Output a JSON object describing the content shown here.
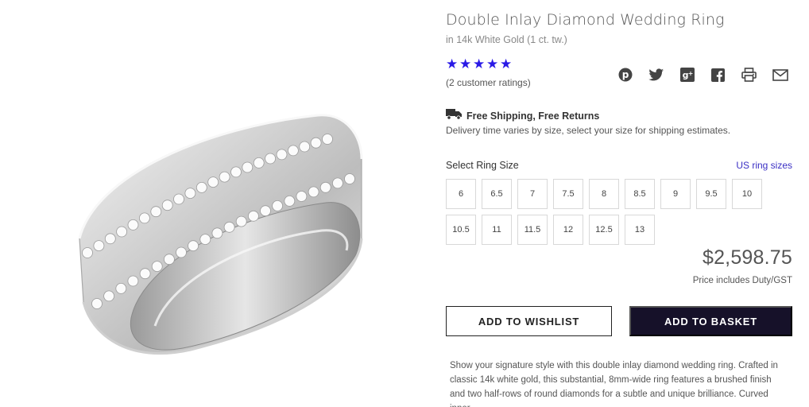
{
  "product": {
    "title": "Double Inlay Diamond Wedding Ring",
    "subtitle": "in 14k White Gold (1 ct. tw.)",
    "image_icon": "ring-image"
  },
  "rating": {
    "stars": 5,
    "star_color": "#2a1ae6",
    "ratings_text": "(2 customer ratings)"
  },
  "share": {
    "icons": [
      "pinterest-icon",
      "twitter-icon",
      "google-plus-icon",
      "facebook-icon",
      "print-icon",
      "email-icon"
    ]
  },
  "shipping": {
    "icon": "truck-icon",
    "title": "Free Shipping, Free Returns",
    "note": "Delivery time varies by size, select your size for shipping estimates."
  },
  "sizes": {
    "label": "Select Ring Size",
    "link": "US ring sizes",
    "options": [
      "6",
      "6.5",
      "7",
      "7.5",
      "8",
      "8.5",
      "9",
      "9.5",
      "10",
      "10.5",
      "11",
      "11.5",
      "12",
      "12.5",
      "13"
    ]
  },
  "pricing": {
    "price": "$2,598.75",
    "note": "Price includes Duty/GST"
  },
  "actions": {
    "wishlist_label": "ADD TO WISHLIST",
    "basket_label": "ADD TO BASKET",
    "basket_color": "#161129"
  },
  "description": "Show your signature style with this double inlay diamond wedding ring. Crafted in classic 14k white gold, this substantial, 8mm-wide ring features a brushed finish and two half-rows of round diamonds for a subtle and unique brilliance. Curved inner"
}
